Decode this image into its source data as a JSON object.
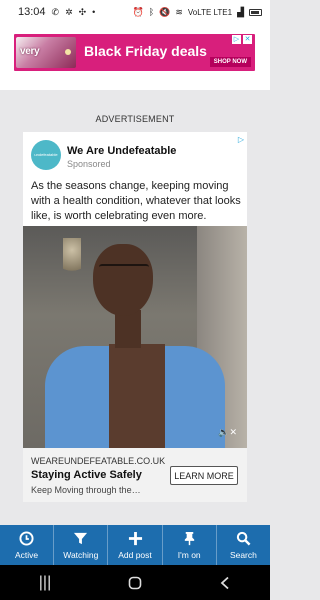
{
  "status_bar": {
    "time": "13:04",
    "network": "VoLTE LTE1",
    "left_icons": [
      "whatsapp-icon",
      "settings-icon",
      "sync-icon",
      "notification-dot"
    ],
    "right_icons": [
      "alarm-icon",
      "bluetooth-icon",
      "mute-icon",
      "wifi-icon",
      "signal-icon",
      "battery-icon"
    ]
  },
  "banner_ad": {
    "logo_text": "very",
    "title": "Black Friday deals",
    "cta": "SHOP NOW",
    "background_color": "#d81f7c"
  },
  "ad_section": {
    "heading": "ADVERTISEMENT"
  },
  "ad_card": {
    "advertiser_name": "We Are Undefeatable",
    "advertiser_logo_text": "undefeatable",
    "sponsored_label": "Sponsored",
    "body": "As the seasons change, keeping moving with a health condition, whatever that looks like, is worth celebrating even more.",
    "domain": "WEAREUNDEFEATABLE.CO.UK",
    "headline": "Staying Active Safely",
    "description": "Keep Moving through the…",
    "cta": "LEARN MORE"
  },
  "bottom_tabs": [
    {
      "label": "Active",
      "icon": "clock-icon"
    },
    {
      "label": "Watching",
      "icon": "filter-icon"
    },
    {
      "label": "Add post",
      "icon": "plus-icon"
    },
    {
      "label": "I'm on",
      "icon": "pin-icon"
    },
    {
      "label": "Search",
      "icon": "search-icon"
    }
  ],
  "nav_bar": {
    "buttons": [
      "recents-icon",
      "home-icon",
      "back-icon"
    ]
  },
  "colors": {
    "tab_bar": "#1d6dae",
    "accent": "#2aa8dc"
  }
}
